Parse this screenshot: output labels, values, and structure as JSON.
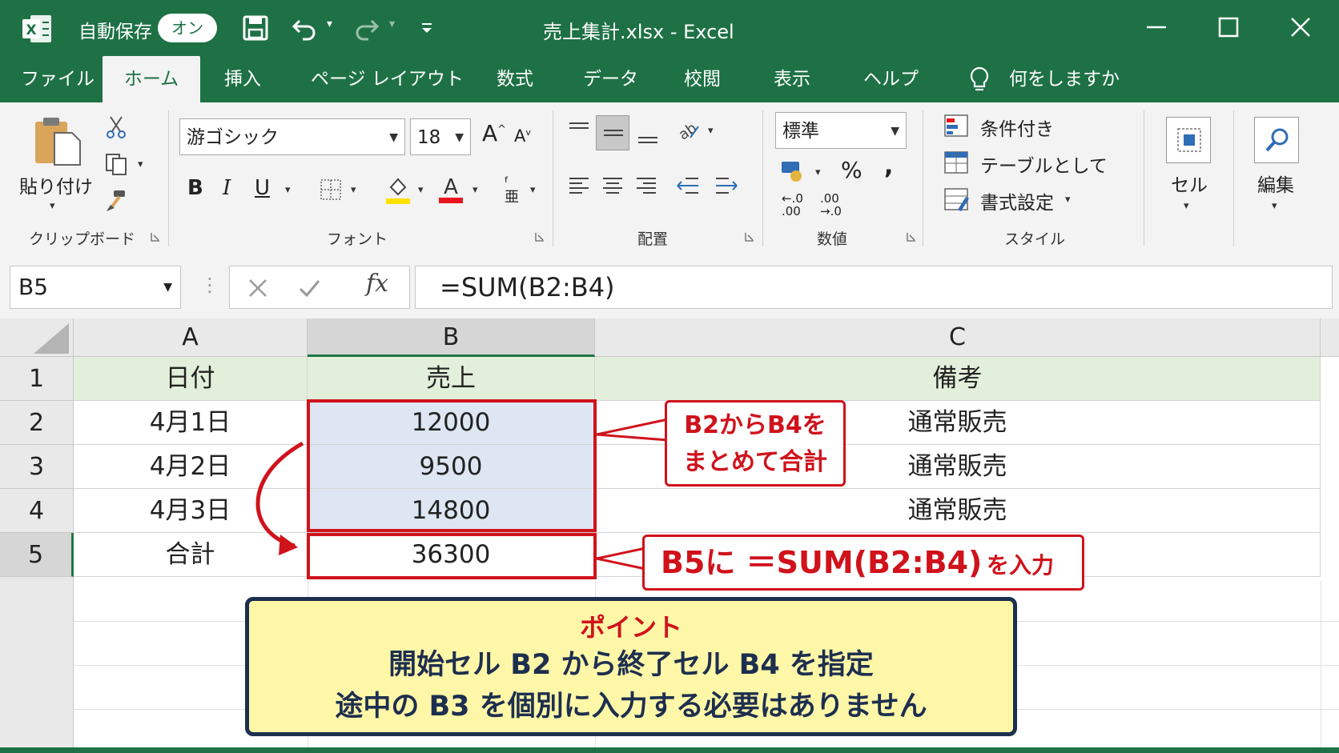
{
  "titlebar": {
    "autosave_label": "自動保存",
    "autosave_state": "オン",
    "title": "売上集計.xlsx  -  Excel"
  },
  "tabs": [
    "ファイル",
    "ホーム",
    "挿入",
    "ページ レイアウト",
    "数式",
    "データ",
    "校閲",
    "表示",
    "ヘルプ"
  ],
  "tell_me": "何をしますか",
  "ribbon": {
    "clipboard": {
      "paste_label": "貼り付け",
      "group_label": "クリップボード"
    },
    "font": {
      "font_name": "游ゴシック",
      "font_size": "18",
      "bold": "B",
      "italic": "I",
      "underline": "U",
      "group_label": "フォント"
    },
    "alignment": {
      "group_label": "配置"
    },
    "number": {
      "format": "標準",
      "percent": "%",
      "comma": ",",
      "inc_decimal": "←.0\n.00",
      "dec_decimal": ".00\n→.0",
      "group_label": "数値"
    },
    "styles": {
      "conditional": "条件付き",
      "table": "テーブルとして",
      "cell_format": "書式設定",
      "group_label": "スタイル"
    },
    "cells": {
      "label": "セル"
    },
    "editing": {
      "label": "編集"
    }
  },
  "formula_bar": {
    "name_box": "B5",
    "fx": "fx",
    "formula": "=SUM(B2:B4)"
  },
  "sheet": {
    "columns": [
      "A",
      "B",
      "C"
    ],
    "rows": [
      "1",
      "2",
      "3",
      "4",
      "5"
    ],
    "cells": [
      [
        "日付",
        "売上",
        "備考"
      ],
      [
        "4月1日",
        "12000",
        "通常販売"
      ],
      [
        "4月2日",
        "9500",
        "通常販売"
      ],
      [
        "4月3日",
        "14800",
        "通常販売"
      ],
      [
        "合計",
        "36300",
        ""
      ]
    ]
  },
  "callouts": {
    "range_line1": "B2からB4を",
    "range_line2": "まとめて合計",
    "input_main": "B5に ＝SUM(B2:B4)",
    "input_suffix": "を入力"
  },
  "point": {
    "title": "ポイント",
    "line1": "開始セル B2 から終了セル B4 を指定",
    "line2": "途中の B3 を個別に入力する必要はありません"
  },
  "colors": {
    "excel_green": "#1e7145",
    "accent_red": "#d0121b",
    "header_fill": "#e2efda",
    "selection_fill": "#dde6f2",
    "point_fill": "#fff7a8"
  }
}
